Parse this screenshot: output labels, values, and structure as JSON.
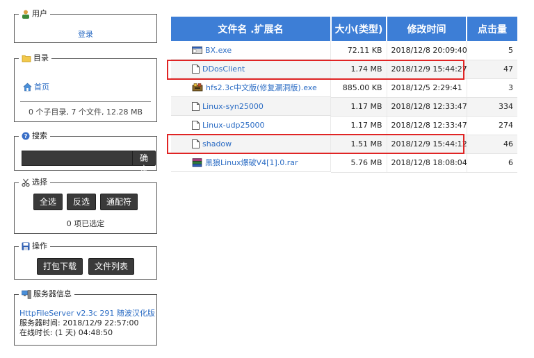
{
  "panels": {
    "user": {
      "title": "用户",
      "login": "登录"
    },
    "dir": {
      "title": "目录",
      "home": "首页",
      "summary": "0 个子目录, 7 个文件, 12.28 MB"
    },
    "search": {
      "title": "搜索",
      "placeholder": "",
      "button": "确定"
    },
    "select": {
      "title": "选择",
      "buttons": [
        "全选",
        "反选",
        "通配符"
      ],
      "status": "0 项已选定"
    },
    "actions": {
      "title": "操作",
      "buttons": [
        "打包下载",
        "文件列表"
      ]
    },
    "server": {
      "title": "服务器信息",
      "version": "HttpFileServer v2.3c 291 随波汉化版",
      "time": "服务器时间: 2018/12/9 22:57:00",
      "uptime": "在线时长: (1 天) 04:48:50"
    }
  },
  "table": {
    "headers": [
      "文件名 .扩展名",
      "大小(类型)",
      "修改时间",
      "点击量"
    ],
    "rows": [
      {
        "icon": "exe-icon",
        "name": "BX.exe",
        "size": "72.11 KB",
        "modified": "2018/12/8 20:09:40",
        "hits": "5"
      },
      {
        "icon": "file-icon",
        "name": "DDosClient",
        "size": "1.74 MB",
        "modified": "2018/12/9 15:44:27",
        "hits": "47"
      },
      {
        "icon": "installer-icon",
        "name": "hfs2.3c中文版(修复漏洞版).exe",
        "size": "885.00 KB",
        "modified": "2018/12/5 2:29:41",
        "hits": "3"
      },
      {
        "icon": "file-icon",
        "name": "Linux-syn25000",
        "size": "1.17 MB",
        "modified": "2018/12/8 12:33:47",
        "hits": "334"
      },
      {
        "icon": "file-icon",
        "name": "Linux-udp25000",
        "size": "1.17 MB",
        "modified": "2018/12/8 12:33:47",
        "hits": "274"
      },
      {
        "icon": "file-icon",
        "name": "shadow",
        "size": "1.51 MB",
        "modified": "2018/12/9 15:44:12",
        "hits": "46"
      },
      {
        "icon": "rar-icon",
        "name": "黑狼Linux爆破V4[1].0.rar",
        "size": "5.76 MB",
        "modified": "2018/12/8 18:08:04",
        "hits": "6"
      }
    ]
  },
  "colors": {
    "header_bg": "#3d7ed6",
    "highlight": "#e02424",
    "link": "#2b6cc4"
  }
}
